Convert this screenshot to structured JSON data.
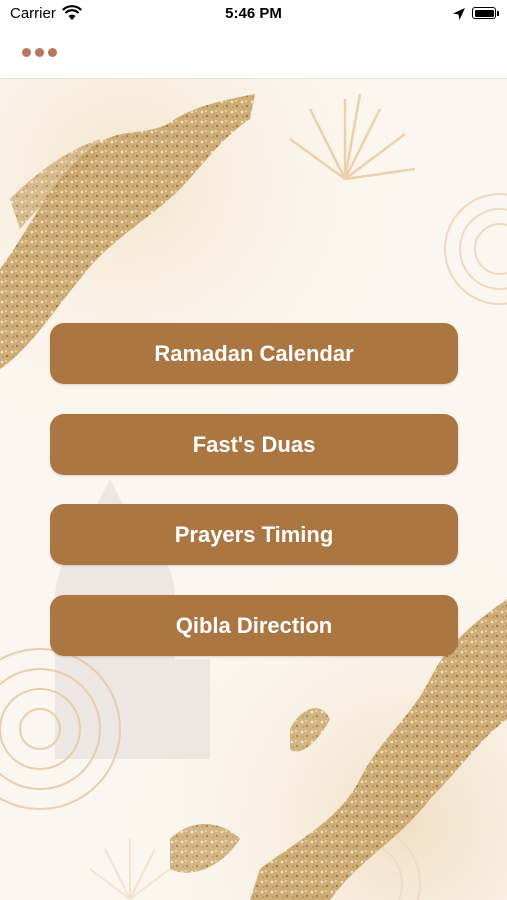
{
  "status_bar": {
    "carrier": "Carrier",
    "time": "5:46 PM"
  },
  "nav": {
    "more_icon": "ellipsis-icon"
  },
  "menu": {
    "items": [
      {
        "label": "Ramadan Calendar"
      },
      {
        "label": "Fast's Duas"
      },
      {
        "label": "Prayers Timing"
      },
      {
        "label": "Qibla Direction"
      }
    ]
  },
  "colors": {
    "button": "#ab7641",
    "dots": "#b8765a",
    "gold": "#c9a56b"
  }
}
